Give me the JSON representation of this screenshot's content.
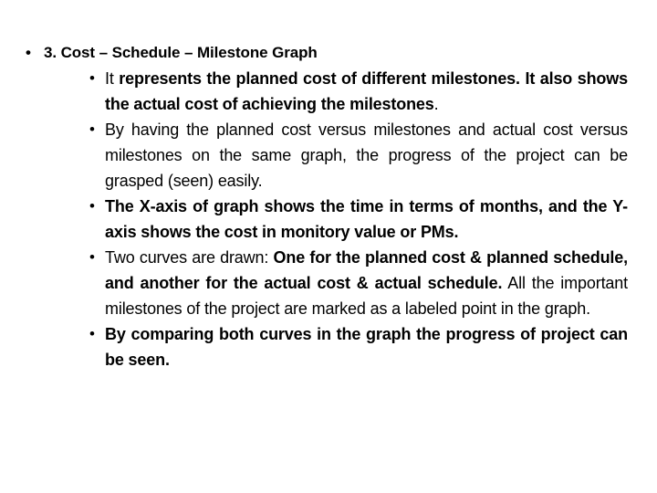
{
  "slide": {
    "background_color": "#ffffff",
    "text_color": "#000000",
    "bullet_glyph": "•"
  },
  "heading": {
    "bullet": "•",
    "text": "3. Cost – Schedule – Milestone Graph"
  },
  "bullets": [
    {
      "bullet": "•",
      "segments": [
        {
          "weight": "regular",
          "text": "It "
        },
        {
          "weight": "bold",
          "text": "represents the planned cost of different milestones. It also shows the actual cost of achieving the milestones"
        },
        {
          "weight": "regular",
          "text": "."
        }
      ],
      "plain_text": "It represents the planned cost of different milestones. It also shows the actual cost of achieving the milestones."
    },
    {
      "bullet": "•",
      "segments": [
        {
          "weight": "regular",
          "text": "By having the planned cost versus milestones and actual cost versus milestones on the same graph, the progress of the project can be grasped (seen) easily."
        }
      ],
      "plain_text": "By having the planned cost versus milestones and actual cost versus milestones on the same graph, the progress of the project can be grasped (seen) easily."
    },
    {
      "bullet": "•",
      "segments": [
        {
          "weight": "bold",
          "text": "The X-axis of graph shows the time in terms of months, and the Y-axis shows the cost in monitory value or PMs."
        }
      ],
      "plain_text": "The X-axis of graph shows the time in terms of months, and the Y-axis shows the cost in monitory value or PMs."
    },
    {
      "bullet": "•",
      "segments": [
        {
          "weight": "regular",
          "text": "Two curves are drawn: "
        },
        {
          "weight": "bold",
          "text": "One for the planned cost & planned schedule, and another for the actual cost & actual schedule."
        },
        {
          "weight": "regular",
          "text": " All the important milestones of the project are marked as a labeled point in the graph."
        }
      ],
      "plain_text": "Two curves are drawn: One for the planned cost & planned schedule, and another for the actual cost & actual schedule. All the important milestones of the project are marked as a labeled point in the graph."
    },
    {
      "bullet": "•",
      "segments": [
        {
          "weight": "bold",
          "text": "By comparing both curves in the graph the progress of project can be seen."
        }
      ],
      "plain_text": "By comparing both curves in the graph the progress of project can be seen."
    }
  ]
}
